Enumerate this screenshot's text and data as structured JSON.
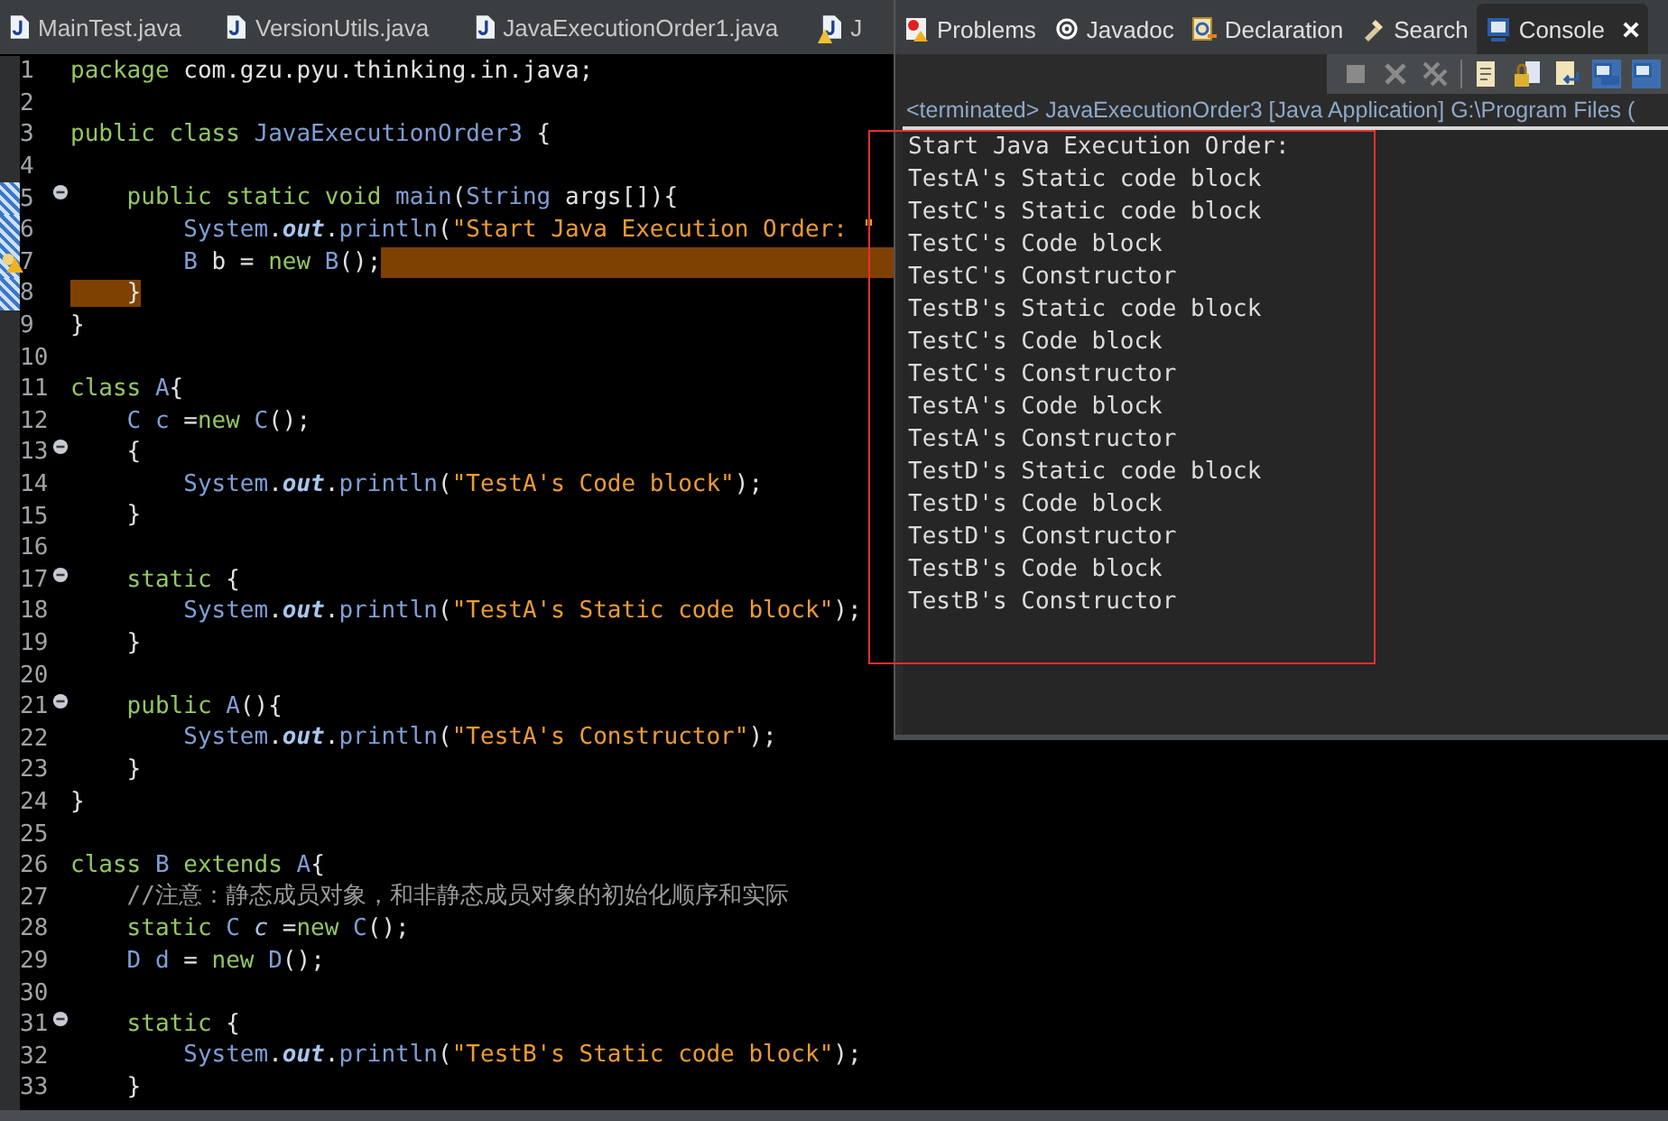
{
  "editor": {
    "tabs": [
      {
        "label": "MainTest.java",
        "warning": false
      },
      {
        "label": "VersionUtils.java",
        "warning": false
      },
      {
        "label": "JavaExecutionOrder1.java",
        "warning": false
      },
      {
        "label": "J",
        "warning": true
      }
    ],
    "lines": [
      {
        "number": "1",
        "segments": [
          {
            "kind": "keyword",
            "text": "package"
          },
          {
            "kind": "plain",
            "text": " com.gzu.pyu.thinking.in.java;"
          }
        ]
      },
      {
        "number": "2"
      },
      {
        "number": "3",
        "segments": [
          {
            "kind": "keyword",
            "text": "public class "
          },
          {
            "kind": "type",
            "text": "JavaExecutionOrder3"
          },
          {
            "kind": "plain",
            "text": " {"
          }
        ]
      },
      {
        "number": "4"
      },
      {
        "number": "5",
        "fold": true,
        "marked": true,
        "segments": [
          {
            "kind": "keyword",
            "text": "    public static void "
          },
          {
            "kind": "type",
            "text": "main"
          },
          {
            "kind": "plain",
            "text": "("
          },
          {
            "kind": "type",
            "text": "String"
          },
          {
            "kind": "plain",
            "text": " args[]){"
          }
        ]
      },
      {
        "number": "6",
        "marked": true,
        "segments": [
          {
            "kind": "type",
            "text": "        System"
          },
          {
            "kind": "plain",
            "text": "."
          },
          {
            "kind": "field",
            "text": "out"
          },
          {
            "kind": "plain",
            "text": "."
          },
          {
            "kind": "type",
            "text": "println"
          },
          {
            "kind": "plain",
            "text": "("
          },
          {
            "kind": "string",
            "text": "\"Start Java Execution Order: \""
          }
        ]
      },
      {
        "number": "7",
        "marked": true,
        "warning": true,
        "highlight_rest": true,
        "segments": [
          {
            "kind": "type",
            "text": "        B "
          },
          {
            "kind": "plain",
            "text": "b = "
          },
          {
            "kind": "keyword",
            "text": "new "
          },
          {
            "kind": "type",
            "text": "B"
          },
          {
            "kind": "plain",
            "text": "();"
          }
        ]
      },
      {
        "number": "8",
        "marked": true,
        "segments": [
          {
            "kind": "highlighted",
            "text": "    }"
          }
        ]
      },
      {
        "number": "9",
        "segments": [
          {
            "kind": "plain",
            "text": "}"
          }
        ]
      },
      {
        "number": "10"
      },
      {
        "number": "11",
        "segments": [
          {
            "kind": "keyword",
            "text": "class "
          },
          {
            "kind": "type",
            "text": "A"
          },
          {
            "kind": "plain",
            "text": "{"
          }
        ]
      },
      {
        "number": "12",
        "segments": [
          {
            "kind": "type",
            "text": "    C c "
          },
          {
            "kind": "plain",
            "text": "="
          },
          {
            "kind": "keyword",
            "text": "new "
          },
          {
            "kind": "type",
            "text": "C"
          },
          {
            "kind": "plain",
            "text": "();"
          }
        ]
      },
      {
        "number": "13",
        "fold": true,
        "segments": [
          {
            "kind": "plain",
            "text": "    {"
          }
        ]
      },
      {
        "number": "14",
        "segments": [
          {
            "kind": "type",
            "text": "        System"
          },
          {
            "kind": "plain",
            "text": "."
          },
          {
            "kind": "field",
            "text": "out"
          },
          {
            "kind": "plain",
            "text": "."
          },
          {
            "kind": "type",
            "text": "println"
          },
          {
            "kind": "plain",
            "text": "("
          },
          {
            "kind": "string",
            "text": "\"TestA's Code block\""
          },
          {
            "kind": "plain",
            "text": ");"
          }
        ]
      },
      {
        "number": "15",
        "segments": [
          {
            "kind": "plain",
            "text": "    }"
          }
        ]
      },
      {
        "number": "16"
      },
      {
        "number": "17",
        "fold": true,
        "segments": [
          {
            "kind": "keyword",
            "text": "    static"
          },
          {
            "kind": "plain",
            "text": " {"
          }
        ]
      },
      {
        "number": "18",
        "segments": [
          {
            "kind": "type",
            "text": "        System"
          },
          {
            "kind": "plain",
            "text": "."
          },
          {
            "kind": "field",
            "text": "out"
          },
          {
            "kind": "plain",
            "text": "."
          },
          {
            "kind": "type",
            "text": "println"
          },
          {
            "kind": "plain",
            "text": "("
          },
          {
            "kind": "string",
            "text": "\"TestA's Static code block\""
          },
          {
            "kind": "plain",
            "text": ");"
          }
        ]
      },
      {
        "number": "19",
        "segments": [
          {
            "kind": "plain",
            "text": "    }"
          }
        ]
      },
      {
        "number": "20"
      },
      {
        "number": "21",
        "fold": true,
        "segments": [
          {
            "kind": "keyword",
            "text": "    public "
          },
          {
            "kind": "type",
            "text": "A"
          },
          {
            "kind": "plain",
            "text": "(){"
          }
        ]
      },
      {
        "number": "22",
        "segments": [
          {
            "kind": "type",
            "text": "        System"
          },
          {
            "kind": "plain",
            "text": "."
          },
          {
            "kind": "field",
            "text": "out"
          },
          {
            "kind": "plain",
            "text": "."
          },
          {
            "kind": "type",
            "text": "println"
          },
          {
            "kind": "plain",
            "text": "("
          },
          {
            "kind": "string",
            "text": "\"TestA's Constructor\""
          },
          {
            "kind": "plain",
            "text": ");"
          }
        ]
      },
      {
        "number": "23",
        "segments": [
          {
            "kind": "plain",
            "text": "    }"
          }
        ]
      },
      {
        "number": "24",
        "segments": [
          {
            "kind": "plain",
            "text": "}"
          }
        ]
      },
      {
        "number": "25"
      },
      {
        "number": "26",
        "segments": [
          {
            "kind": "keyword",
            "text": "class "
          },
          {
            "kind": "type",
            "text": "B "
          },
          {
            "kind": "keyword",
            "text": "extends "
          },
          {
            "kind": "type",
            "text": "A"
          },
          {
            "kind": "plain",
            "text": "{"
          }
        ]
      },
      {
        "number": "27",
        "segments": [
          {
            "kind": "comment",
            "text": "    //注意：静态成员对象，和非静态成员对象的初始化顺序和实际"
          }
        ]
      },
      {
        "number": "28",
        "segments": [
          {
            "kind": "keyword",
            "text": "    static "
          },
          {
            "kind": "type",
            "text": "C "
          },
          {
            "kind": "static-field",
            "text": "c "
          },
          {
            "kind": "plain",
            "text": "="
          },
          {
            "kind": "keyword",
            "text": "new "
          },
          {
            "kind": "type",
            "text": "C"
          },
          {
            "kind": "plain",
            "text": "();"
          }
        ]
      },
      {
        "number": "29",
        "segments": [
          {
            "kind": "type",
            "text": "    D d "
          },
          {
            "kind": "plain",
            "text": "= "
          },
          {
            "kind": "keyword",
            "text": "new "
          },
          {
            "kind": "type",
            "text": "D"
          },
          {
            "kind": "plain",
            "text": "();"
          }
        ]
      },
      {
        "number": "30"
      },
      {
        "number": "31",
        "fold": true,
        "segments": [
          {
            "kind": "keyword",
            "text": "    static"
          },
          {
            "kind": "plain",
            "text": " {"
          }
        ]
      },
      {
        "number": "32",
        "segments": [
          {
            "kind": "type",
            "text": "        System"
          },
          {
            "kind": "plain",
            "text": "."
          },
          {
            "kind": "field",
            "text": "out"
          },
          {
            "kind": "plain",
            "text": "."
          },
          {
            "kind": "type",
            "text": "println"
          },
          {
            "kind": "plain",
            "text": "("
          },
          {
            "kind": "string",
            "text": "\"TestB's Static code block\""
          },
          {
            "kind": "plain",
            "text": ");"
          }
        ]
      },
      {
        "number": "33",
        "segments": [
          {
            "kind": "plain",
            "text": "    }"
          }
        ]
      }
    ]
  },
  "console": {
    "tabs": [
      {
        "label": "Problems",
        "selected": false
      },
      {
        "label": "Javadoc",
        "selected": false
      },
      {
        "label": "Declaration",
        "selected": false
      },
      {
        "label": "Search",
        "selected": false
      },
      {
        "label": "Console",
        "selected": true
      }
    ],
    "status": "<terminated> JavaExecutionOrder3 [Java Application] G:\\Program Files (",
    "output": [
      "Start Java Execution Order:",
      "TestA's Static code block",
      "TestC's Static code block",
      "TestC's Code block",
      "TestC's Constructor",
      "TestB's Static code block",
      "TestC's Code block",
      "TestC's Constructor",
      "TestA's Code block",
      "TestA's Constructor",
      "TestD's Static code block",
      "TestD's Code block",
      "TestD's Constructor",
      "TestB's Code block",
      "TestB's Constructor"
    ]
  }
}
